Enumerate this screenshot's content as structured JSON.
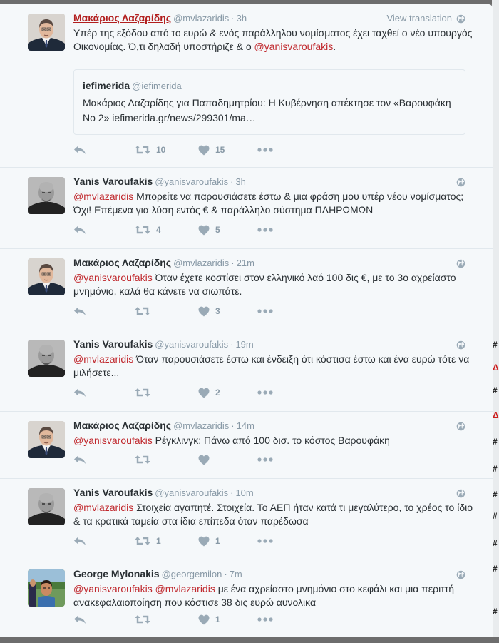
{
  "view_translation": "View translation",
  "background_marks": [
    "#",
    "Δ",
    "#",
    "Δ",
    "#",
    "#",
    "#",
    "#",
    "#",
    "#",
    "#"
  ],
  "tweets": [
    {
      "name": "Μακάριος Λαζαρίδης",
      "handle": "@mvlazaridis",
      "dot": "·",
      "time": "3h",
      "avatar": "man-suit",
      "text_parts": [
        {
          "t": "Υπέρ της εξόδου από το ευρώ & ενός παράλληλου νομίσματος έχει ταχθεί ο νέο υπουργός Οικονομίας. Ό,τι δηλαδή υποστήριζε & ο "
        },
        {
          "t": "@yanisvaroufakis",
          "m": true
        },
        {
          "t": "."
        }
      ],
      "quote": {
        "name": "iefimerida",
        "handle": "@iefimerida",
        "text": "Μακάριος Λαζαρίδης για Παπαδημητρίου: Η Κυβέρνηση απέκτησε τον «Βαρουφάκη Νο 2» iefimerida.gr/news/299301/ma…"
      },
      "retweets": "10",
      "likes": "15"
    },
    {
      "name": "Yanis Varoufakis",
      "handle": "@yanisvaroufakis",
      "dot": "·",
      "time": "3h",
      "avatar": "bald-man",
      "text_parts": [
        {
          "t": "@mvlazaridis",
          "m": true
        },
        {
          "t": " Μπορείτε να παρουσιάσετε έστω & μια φράση μου υπέρ νέου νομίσματος; Όχι! Επέμενα για λύση εντός € & παράλληλο σύστημα ΠΛΗΡΩΜΩΝ"
        }
      ],
      "retweets": "4",
      "likes": "5"
    },
    {
      "name": "Μακάριος Λαζαρίδης",
      "handle": "@mvlazaridis",
      "dot": "·",
      "time": "21m",
      "avatar": "man-suit",
      "text_parts": [
        {
          "t": "@yanisvaroufakis",
          "m": true
        },
        {
          "t": " Όταν έχετε κοστίσει στον ελληνικό λαό 100 δις €, με το 3ο αχρείαστο μνημόνιο, καλά θα κάνετε να σιωπάτε."
        }
      ],
      "retweets": "",
      "likes": "3"
    },
    {
      "name": "Yanis Varoufakis",
      "handle": "@yanisvaroufakis",
      "dot": "·",
      "time": "19m",
      "avatar": "bald-man",
      "text_parts": [
        {
          "t": "@mvlazaridis",
          "m": true
        },
        {
          "t": " Όταν παρουσιάσετε έστω και ένδειξη ότι κόστισα έστω και ένα ευρώ τότε να μιλήσετε..."
        }
      ],
      "retweets": "",
      "likes": "2"
    },
    {
      "name": "Μακάριος Λαζαρίδης",
      "handle": "@mvlazaridis",
      "dot": "·",
      "time": "14m",
      "avatar": "man-suit",
      "text_parts": [
        {
          "t": "@yanisvaroufakis",
          "m": true
        },
        {
          "t": " Ρέγκλινγκ: Πάνω από 100 δισ. το κόστος Βαρουφάκη"
        }
      ],
      "retweets": "",
      "likes": ""
    },
    {
      "name": "Yanis Varoufakis",
      "handle": "@yanisvaroufakis",
      "dot": "·",
      "time": "10m",
      "avatar": "bald-man",
      "text_parts": [
        {
          "t": "@mvlazaridis",
          "m": true
        },
        {
          "t": " Στοιχεία αγαπητέ. Στοιχεία. Το ΑΕΠ ήταν κατά τι μεγαλύτερο, το χρέος το ίδιο & τα κρατικά ταμεία στα ίδια επίπεδα όταν παρέδωσα"
        }
      ],
      "retweets": "1",
      "likes": "1"
    },
    {
      "name": "George Mylonakis",
      "handle": "@georgemilon",
      "dot": "·",
      "time": "7m",
      "avatar": "man-outdoor",
      "text_parts": [
        {
          "t": "@yanisvaroufakis",
          "m": true
        },
        {
          "t": " "
        },
        {
          "t": "@mvlazaridis",
          "m": true
        },
        {
          "t": " με ένα αχρείαστο μνημόνιο στο κεφάλι και μια περιττή ανακεφαλαιοποίηση που κόστισε 38 δις ευρώ αυνολικα"
        }
      ],
      "retweets": "",
      "likes": "1"
    }
  ]
}
